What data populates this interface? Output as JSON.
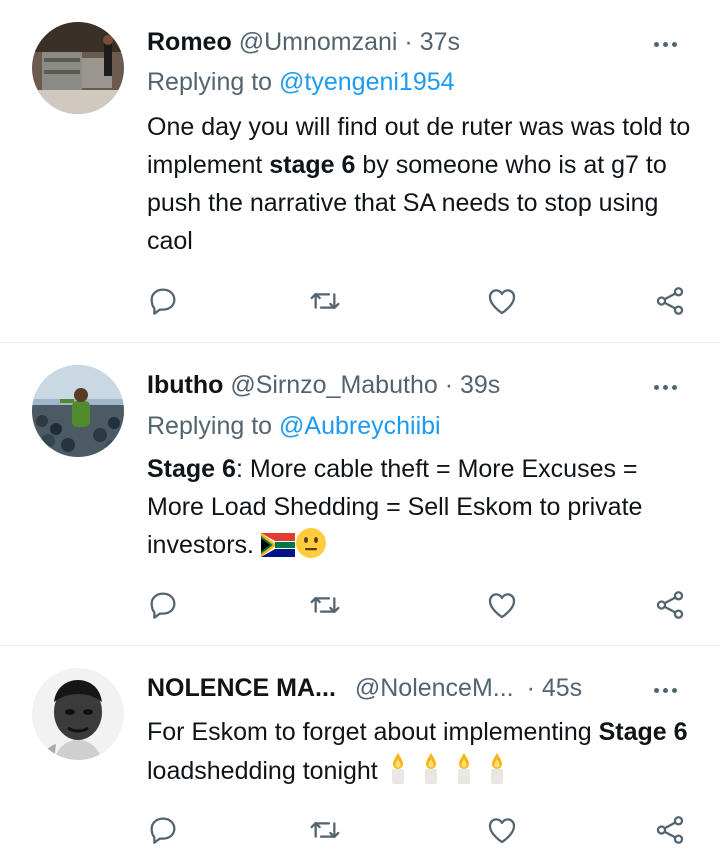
{
  "tweets": [
    {
      "name": "Romeo",
      "handle": "@Umnomzani",
      "sep": "·",
      "time": "37s",
      "replying_prefix": "Replying to",
      "replying_to": "@tyengeni1954",
      "text_a": "One day you will find out de ruter was was told to implement ",
      "text_bold": "stage 6",
      "text_b": " by someone who is at g7 to push the narrative that SA needs to stop using caol"
    },
    {
      "name": "Ibutho",
      "handle": "@Sirnzo_Mabutho",
      "sep": "·",
      "time": "39s",
      "replying_prefix": "Replying to",
      "replying_to": "@Aubreychiibi",
      "text_bold": "Stage 6",
      "text_b": ": More cable theft = More Excuses = More Load Shedding = Sell Eskom to private investors. "
    },
    {
      "name": "NOLENCE MA...",
      "handle": "@NolenceM...",
      "sep": "·",
      "time": "45s",
      "text_a": "For Eskom to forget about implementing ",
      "text_bold": "Stage 6",
      "text_b": " loadshedding tonight "
    }
  ],
  "icons": [
    "reply-icon",
    "retweet-icon",
    "like-icon",
    "share-icon",
    "more-icon"
  ],
  "colors": {
    "link": "#1d9bf0",
    "secondary": "#536471",
    "divider": "#e6ecf0"
  }
}
